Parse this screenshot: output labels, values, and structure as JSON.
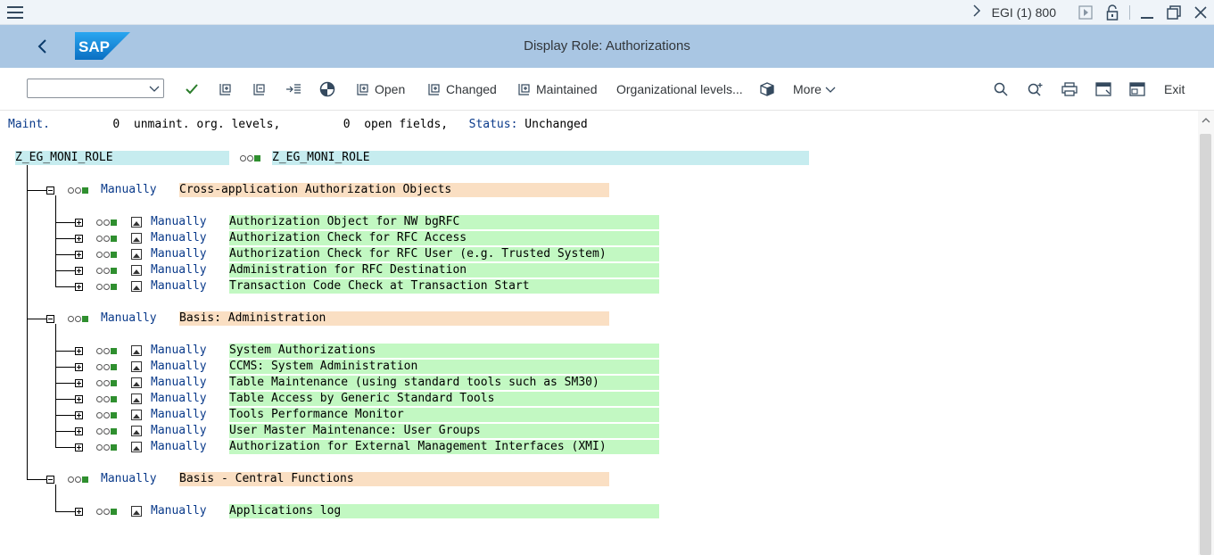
{
  "system": {
    "system_label": "EGI (1) 800",
    "icons": [
      "hamburger-icon",
      "chevron-right-icon",
      "play-icon",
      "lock-icon",
      "minimize-icon",
      "restore-icon",
      "close-icon"
    ]
  },
  "titlebar": {
    "title": "Display Role: Authorizations",
    "logo_text": "SAP",
    "brand_color": "#1a73c7"
  },
  "toolbar": {
    "dropdown_value": "",
    "open_label": "Open",
    "changed_label": "Changed",
    "maintained_label": "Maintained",
    "org_levels_label": "Organizational levels...",
    "more_label": "More",
    "exit_label": "Exit"
  },
  "status": {
    "maint_label": "Maint.",
    "maint_count": "0",
    "unmaint_label": "unmaint. org. levels,",
    "open_count": "0",
    "open_label": "open fields,",
    "status_label": "Status:",
    "status_value": "Unchanged"
  },
  "root": {
    "name_left": "Z_EG_MONI_ROLE",
    "name_right": "Z_EG_MONI_ROLE"
  },
  "groups": [
    {
      "status": "Manually",
      "name": "Cross-application Authorization Objects",
      "items": [
        {
          "status": "Manually",
          "name": "Authorization Object for NW bgRFC"
        },
        {
          "status": "Manually",
          "name": "Authorization Check for RFC Access"
        },
        {
          "status": "Manually",
          "name": "Authorization Check for RFC User (e.g. Trusted System)"
        },
        {
          "status": "Manually",
          "name": "Administration for RFC Destination"
        },
        {
          "status": "Manually",
          "name": "Transaction Code Check at Transaction Start"
        }
      ]
    },
    {
      "status": "Manually",
      "name": "Basis: Administration",
      "items": [
        {
          "status": "Manually",
          "name": "System Authorizations"
        },
        {
          "status": "Manually",
          "name": "CCMS: System Administration"
        },
        {
          "status": "Manually",
          "name": "Table Maintenance (using standard tools such as SM30)"
        },
        {
          "status": "Manually",
          "name": "Table Access by Generic Standard Tools"
        },
        {
          "status": "Manually",
          "name": "Tools Performance Monitor"
        },
        {
          "status": "Manually",
          "name": "User Master Maintenance: User Groups"
        },
        {
          "status": "Manually",
          "name": "Authorization for External Management Interfaces (XMI)"
        }
      ]
    },
    {
      "status": "Manually",
      "name": "Basis - Central Functions",
      "items": [
        {
          "status": "Manually",
          "name": "Applications log"
        }
      ]
    }
  ]
}
